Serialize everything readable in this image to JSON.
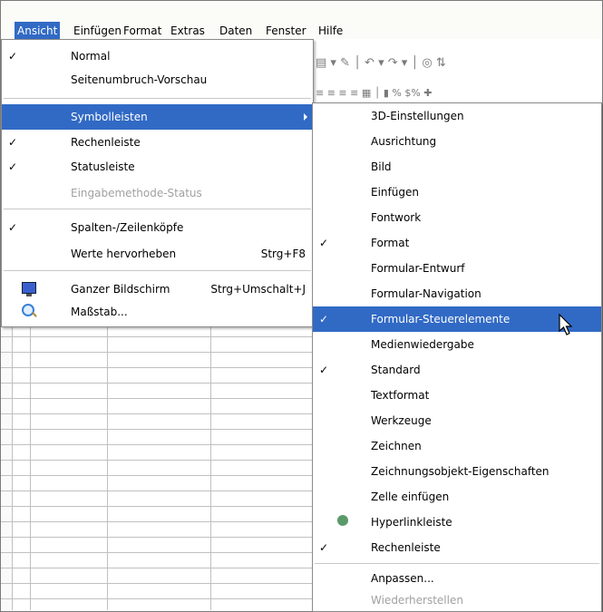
{
  "menubar": {
    "items": [
      {
        "label": "Ansicht",
        "active": true
      },
      {
        "label": "Einfügen"
      },
      {
        "label": "Format"
      },
      {
        "label": "Extras"
      },
      {
        "label": "Daten"
      },
      {
        "label": "Fenster"
      },
      {
        "label": "Hilfe"
      }
    ]
  },
  "ansicht_menu": {
    "items": [
      {
        "label": "Normal",
        "checked": true
      },
      {
        "label": "Seitenumbruch-Vorschau"
      },
      {
        "label": "Symbolleisten",
        "submenu": true,
        "highlighted": true
      },
      {
        "label": "Rechenleiste",
        "checked": true
      },
      {
        "label": "Statusleiste",
        "checked": true
      },
      {
        "label": "Eingabemethode-Status",
        "disabled": true
      },
      {
        "label": "Spalten-/Zeilenköpfe",
        "checked": true
      },
      {
        "label": "Werte hervorheben",
        "shortcut": "Strg+F8"
      },
      {
        "label": "Ganzer Bildschirm",
        "shortcut": "Strg+Umschalt+J",
        "icon": "fullscreen-icon"
      },
      {
        "label": "Maßstab...",
        "icon": "zoom-icon"
      }
    ]
  },
  "symbolleisten_menu": {
    "items": [
      {
        "label": "3D-Einstellungen"
      },
      {
        "label": "Ausrichtung"
      },
      {
        "label": "Bild"
      },
      {
        "label": "Einfügen"
      },
      {
        "label": "Fontwork"
      },
      {
        "label": "Format",
        "checked": true
      },
      {
        "label": "Formular-Entwurf"
      },
      {
        "label": "Formular-Navigation"
      },
      {
        "label": "Formular-Steuerelemente",
        "checked": true,
        "highlighted": true
      },
      {
        "label": "Medienwiedergabe"
      },
      {
        "label": "Standard",
        "checked": true
      },
      {
        "label": "Textformat"
      },
      {
        "label": "Werkzeuge"
      },
      {
        "label": "Zeichnen"
      },
      {
        "label": "Zeichnungsobjekt-Eigenschaften"
      },
      {
        "label": "Zelle einfügen"
      },
      {
        "label": "Hyperlinkleiste",
        "icon": "hyperlink-icon"
      },
      {
        "label": "Rechenleiste",
        "checked": true
      },
      {
        "label": "Anpassen..."
      },
      {
        "label": "Wiederherstellen",
        "disabled": true
      }
    ]
  },
  "check_glyph": "✓",
  "colors": {
    "highlight": "#316ac5",
    "disabled": "#a0a0a0"
  }
}
